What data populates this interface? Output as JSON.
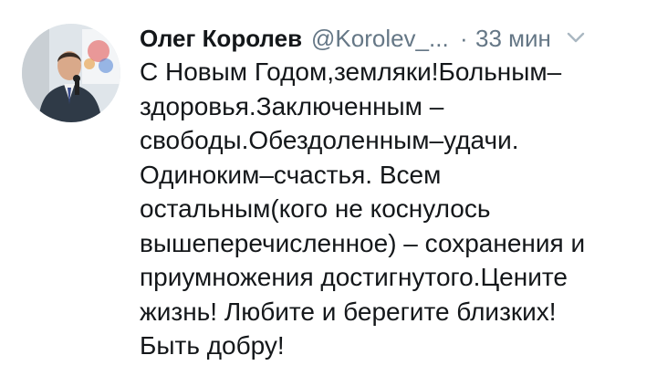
{
  "tweet": {
    "author_name": "Олег Королев",
    "handle": "@Korolev_...",
    "separator": "·",
    "time": "33 мин",
    "icons": {
      "menu": "chevron-down-icon",
      "avatar": "profile-photo"
    },
    "text_lines": [
      "С Новым Годом,земляки!Больным–",
      "здоровья.Заключенным –",
      "свободы.Обездоленным–удачи.",
      "Одиноким–счастья. Всем",
      "остальным(кого не коснулось",
      "вышеперечисленное) – сохранения и",
      "приумножения достигнутого.Цените",
      "жизнь! Любите и берегите близких!",
      "Быть добру!"
    ],
    "colors": {
      "name": "#14171a",
      "secondary": "#657786",
      "chevron": "#aab8c2"
    }
  }
}
